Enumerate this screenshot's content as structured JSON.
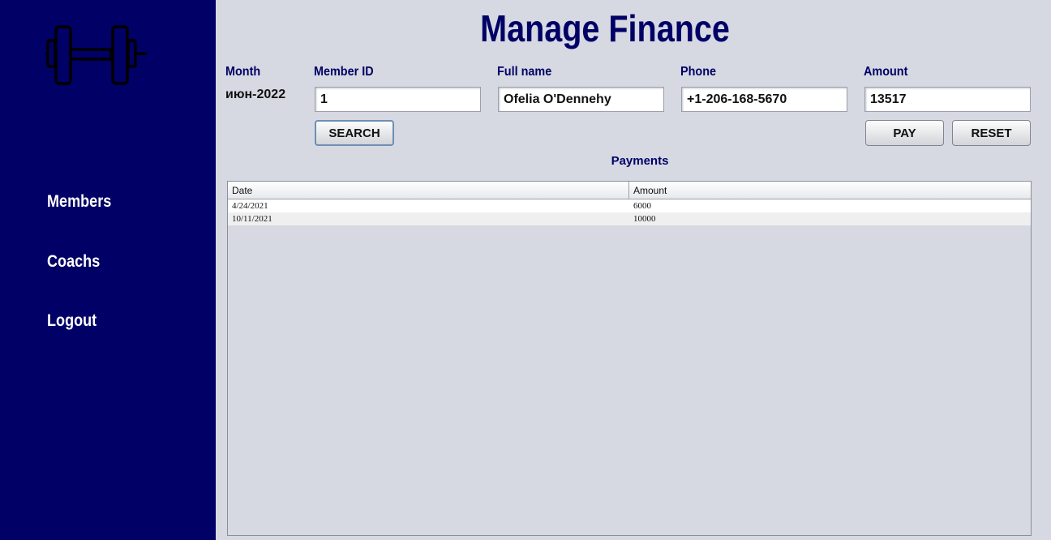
{
  "sidebar": {
    "logo": "dumbbell-icon",
    "items": [
      {
        "label": "Members"
      },
      {
        "label": "Coachs"
      },
      {
        "label": "Logout"
      }
    ]
  },
  "header": {
    "title": "Manage Finance"
  },
  "form": {
    "month_label": "Month",
    "month_value": "июн-2022",
    "member_id_label": "Member ID",
    "member_id_value": "1",
    "full_name_label": "Full name",
    "full_name_value": "Ofelia O'Dennehy",
    "phone_label": "Phone",
    "phone_value": "+1-206-168-5670",
    "amount_label": "Amount",
    "amount_value": "13517",
    "search_label": "SEARCH",
    "pay_label": "PAY",
    "reset_label": "RESET"
  },
  "payments": {
    "title": "Payments",
    "columns": [
      "Date",
      "Amount"
    ],
    "rows": [
      {
        "date": "4/24/2021",
        "amount": "6000"
      },
      {
        "date": "10/11/2021",
        "amount": "10000"
      }
    ]
  },
  "colors": {
    "sidebar": "#000066",
    "background": "#d6d9e1",
    "accent_text": "#000066"
  }
}
